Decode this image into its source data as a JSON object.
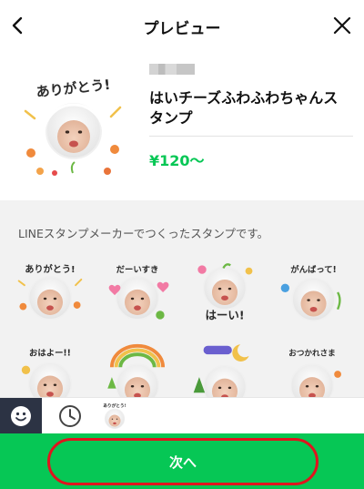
{
  "header": {
    "title": "プレビュー",
    "back_icon": "chevron-left-icon",
    "close_icon": "close-icon"
  },
  "product": {
    "title": "はいチーズふわふわちゃんスタンプ",
    "price": "¥120～",
    "main_sticker_text": "ありがとう!"
  },
  "description": "LINEスタンプメーカーでつくったスタンプです。",
  "stickers": [
    {
      "text": "ありがとう!"
    },
    {
      "text": "だーいすき"
    },
    {
      "text": "はーい!"
    },
    {
      "text": "がんばって!"
    },
    {
      "text": "おはよー!!"
    },
    {
      "text": ""
    },
    {
      "text": ""
    },
    {
      "text": "おつかれさま"
    }
  ],
  "tray": {
    "emoji_tab_icon": "smiley-icon",
    "history_tab_icon": "clock-icon",
    "thumb_text": "ありがとう!"
  },
  "footer": {
    "next_label": "次へ"
  },
  "colors": {
    "accent": "#06c755",
    "highlight": "#e0141e",
    "tray_dark": "#2c3344"
  }
}
